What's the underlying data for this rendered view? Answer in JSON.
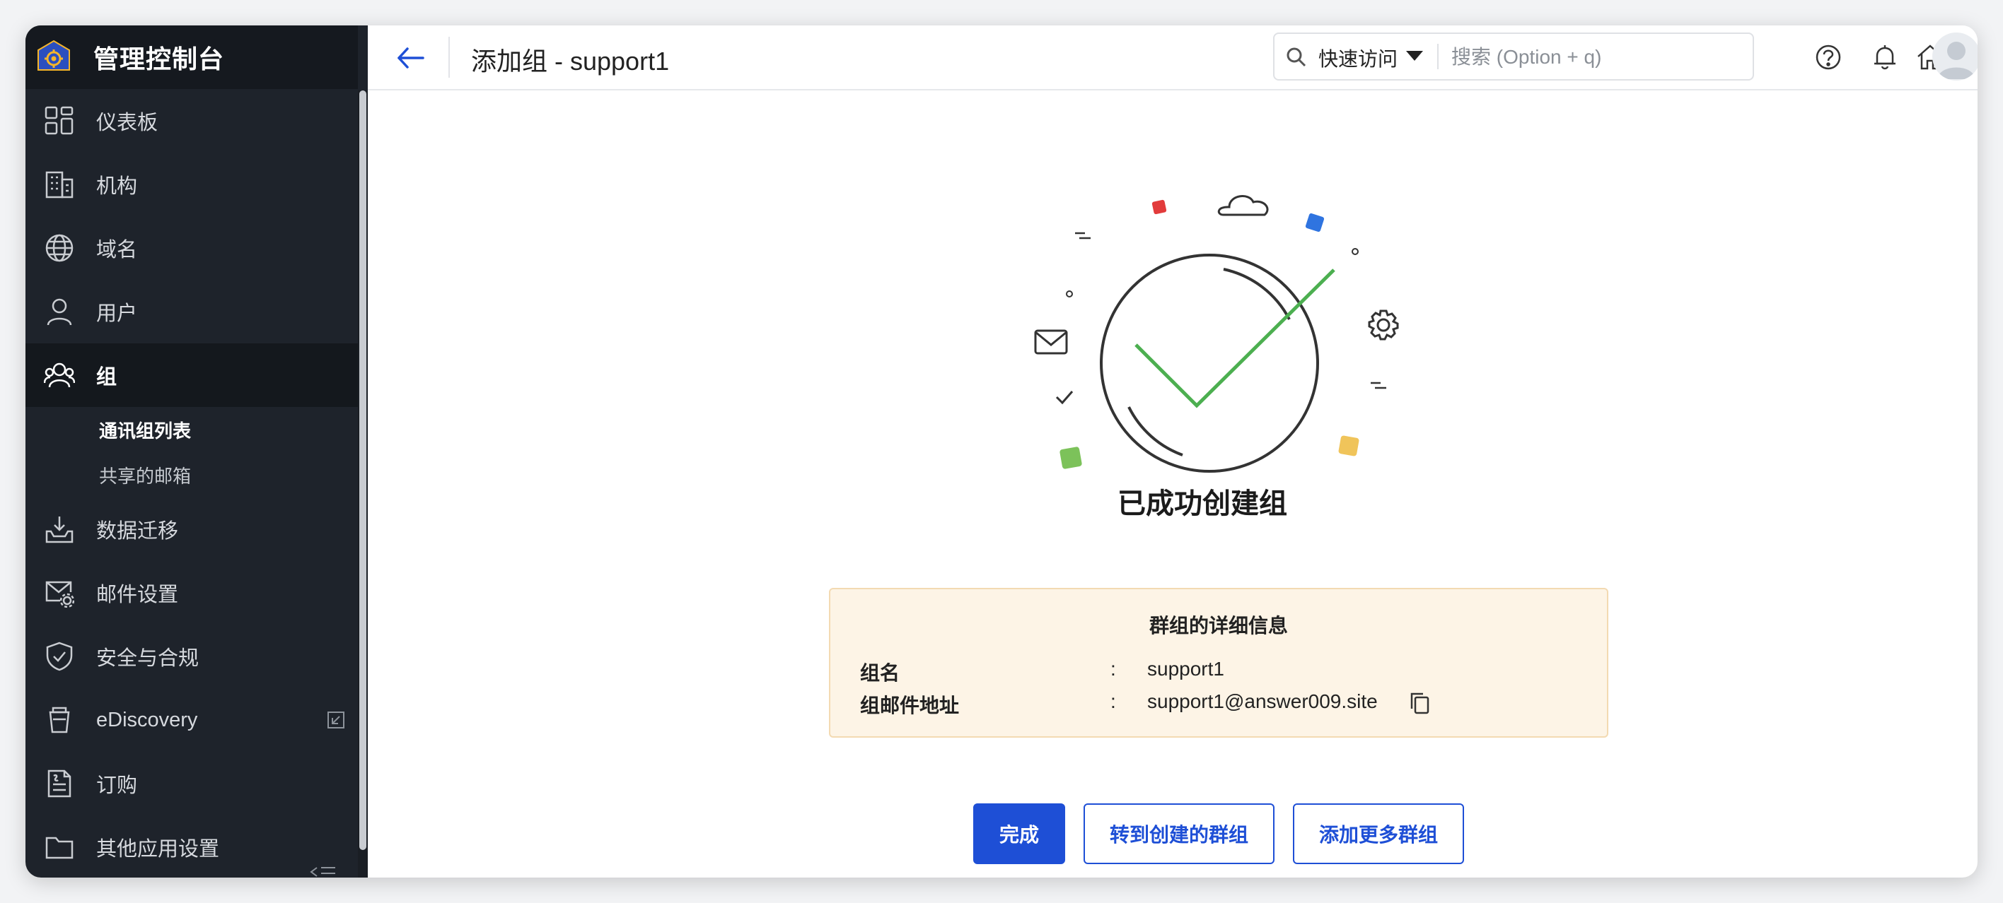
{
  "sidebar": {
    "app_title": "管理控制台",
    "items": [
      {
        "label": "仪表板",
        "icon": "dashboard-icon"
      },
      {
        "label": "机构",
        "icon": "building-icon"
      },
      {
        "label": "域名",
        "icon": "globe-icon"
      },
      {
        "label": "用户",
        "icon": "user-icon"
      },
      {
        "label": "组",
        "icon": "group-icon",
        "active": true
      },
      {
        "label": "数据迁移",
        "icon": "inbox-download-icon"
      },
      {
        "label": "邮件设置",
        "icon": "mail-settings-icon"
      },
      {
        "label": "安全与合规",
        "icon": "shield-check-icon"
      },
      {
        "label": "eDiscovery",
        "icon": "ediscovery-icon",
        "external": true
      },
      {
        "label": "订购",
        "icon": "subscription-icon"
      },
      {
        "label": "其他应用设置",
        "icon": "folder-icon"
      }
    ],
    "sub_items": [
      {
        "label": "通讯组列表",
        "selected": true
      },
      {
        "label": "共享的邮箱"
      }
    ]
  },
  "header": {
    "title": "添加组 - support1",
    "quick_access": "快速访问",
    "search_placeholder": "搜索 (Option + q)"
  },
  "main": {
    "success_title": "已成功创建组",
    "card": {
      "title": "群组的详细信息",
      "rows": [
        {
          "key": "组名",
          "sep": ":",
          "value": "support1"
        },
        {
          "key": "组邮件地址",
          "sep": ":",
          "value": "support1@answer009.site"
        }
      ]
    },
    "buttons": {
      "done": "完成",
      "goto_group": "转到创建的群组",
      "add_more": "添加更多群组"
    }
  },
  "colors": {
    "sidebar_bg": "#1e232b",
    "primary": "#1e4fd6",
    "check_green": "#4caf50",
    "card_bg": "#fdf4e6"
  }
}
